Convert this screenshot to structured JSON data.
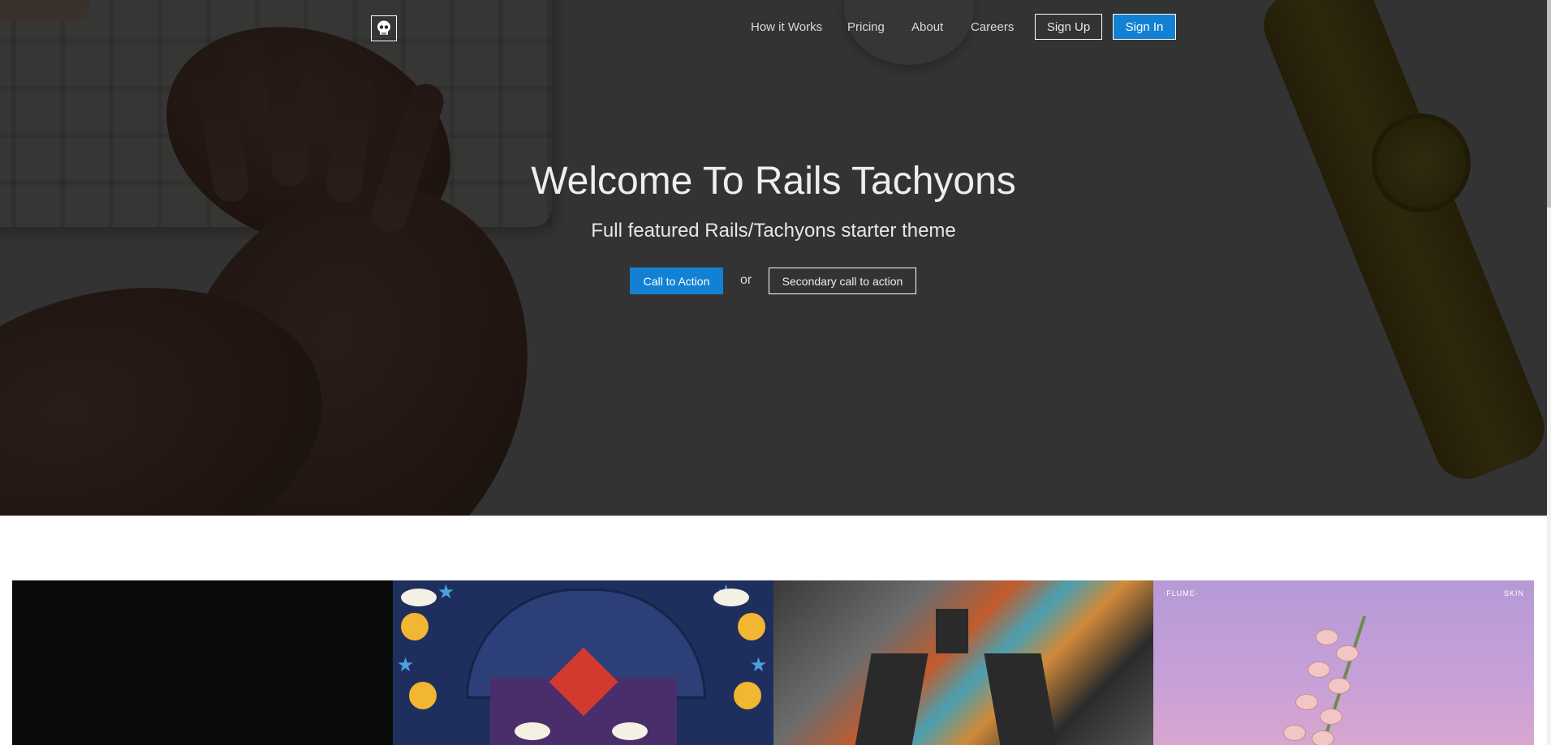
{
  "nav": {
    "logo_icon": "skull-icon",
    "links": [
      "How it Works",
      "Pricing",
      "About",
      "Careers"
    ],
    "sign_up": "Sign Up",
    "sign_in": "Sign In"
  },
  "hero": {
    "title": "Welcome To Rails Tachyons",
    "subtitle": "Full featured Rails/Tachyons starter theme",
    "cta_primary": "Call to Action",
    "cta_or": "or",
    "cta_secondary": "Secondary call to action"
  },
  "albums": {
    "tile4_artist": "·FLUME·",
    "tile4_title": "SKIN"
  },
  "colors": {
    "accent": "#1281d4",
    "hero_overlay": "#000000",
    "nav_text": "#d9d9d9"
  }
}
